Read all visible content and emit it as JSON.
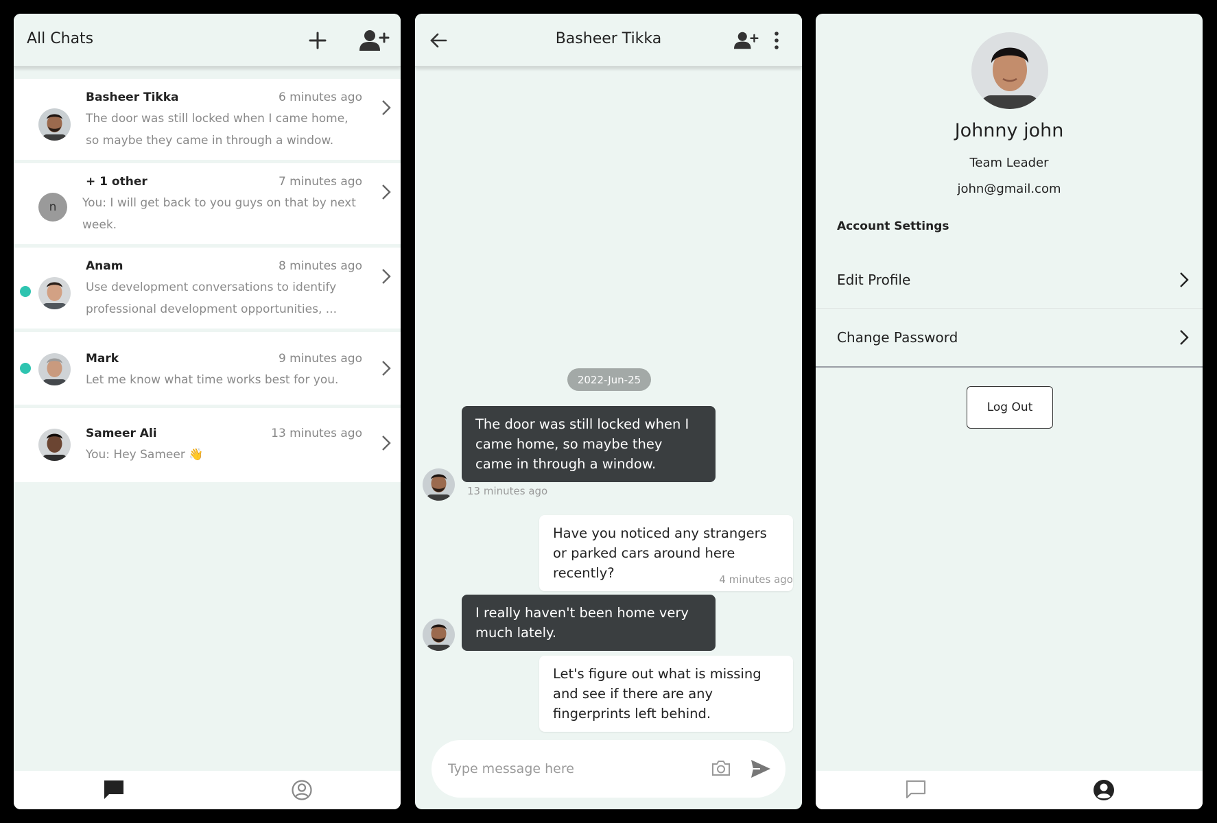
{
  "chats_panel": {
    "title": "All Chats",
    "add_icon": "plus-icon",
    "add_user_icon": "user-plus-icon",
    "items": [
      {
        "name": "Basheer Tikka",
        "time": "6 minutes ago",
        "preview": "The door was still locked when I came home, so maybe they came in through a window.",
        "online": false
      },
      {
        "name": "+ 1 other",
        "time": "7 minutes ago",
        "preview": "You: I will get back to you guys on that by next week.",
        "avatar_letter": "n",
        "online": false
      },
      {
        "name": "Anam",
        "time": "8 minutes ago",
        "preview": "Use development conversations to identify professional development opportunities, ...",
        "online": true
      },
      {
        "name": "Mark",
        "time": "9 minutes ago",
        "preview": "Let me know what time works best for you.",
        "online": true
      },
      {
        "name": "Sameer Ali",
        "time": "13 minutes ago",
        "preview": "You: Hey Sameer 👋",
        "online": false
      }
    ]
  },
  "conversation": {
    "title": "Basheer Tikka",
    "date_separator": "2022-Jun-25",
    "messages": [
      {
        "direction": "in",
        "text": "The door was still locked when I came home, so maybe they came in through a window.",
        "time": "13 minutes ago"
      },
      {
        "direction": "out",
        "text": "Have you noticed any strangers or parked cars around here recently?",
        "time": "4 minutes ago"
      },
      {
        "direction": "in",
        "text": "I really haven't been home very much lately.",
        "time": ""
      },
      {
        "direction": "out",
        "text": "Let's figure out what is missing and see if there are any fingerprints left behind.",
        "time": ""
      }
    ],
    "input_placeholder": "Type message here"
  },
  "profile": {
    "name": "Johnny john",
    "role": "Team Leader",
    "email": "john@gmail.com",
    "section_title": "Account Settings",
    "settings": [
      "Edit Profile",
      "Change Password"
    ],
    "logout_label": "Log Out"
  },
  "colors": {
    "panel_bg": "#edf5f2",
    "incoming_bubble": "#3a3e40",
    "online_dot": "#2ec4b0"
  }
}
